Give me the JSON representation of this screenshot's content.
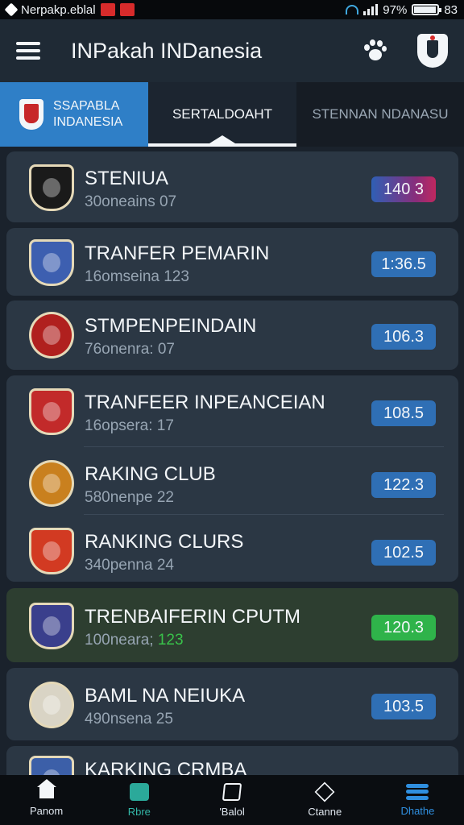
{
  "status_bar": {
    "carrier_text": "Nerpakp.eblal",
    "battery_text": "97%",
    "time": "83",
    "battery_level": 0.97
  },
  "app_bar": {
    "title": "INPakah INDanesia"
  },
  "tabs": [
    {
      "label": "SSAPABLA\nINDANESIA"
    },
    {
      "label": "SERTALDOAHT"
    },
    {
      "label": "STENNAN NDANASU"
    }
  ],
  "rows": [
    {
      "title": "STENIUA",
      "subtitle": "30oneains 07",
      "badge": "140 3",
      "logo_color": "#1a1a1a",
      "logo_shape": "shield"
    },
    {
      "title": "TRANFER PEMARIN",
      "subtitle": "16omseina 123",
      "badge": "1:36.5",
      "logo_color": "#3d5fb0",
      "logo_shape": "shield"
    },
    {
      "title": "STMPENPEINDAIN",
      "subtitle": "76onenra: 07",
      "badge": "106.3",
      "logo_color": "#b0201e",
      "logo_shape": "round"
    },
    {
      "title": "TRANFEER INPEANCEIAN",
      "subtitle": "16opsera: 17",
      "badge": "108.5",
      "logo_color": "#c22a2a",
      "logo_shape": "shield"
    },
    {
      "title": "RAKING CLUB",
      "subtitle": "580nenpe 22",
      "badge": "122.3",
      "logo_color": "#c9801e",
      "logo_shape": "round"
    },
    {
      "title": "RANKING CLURS",
      "subtitle": "340penna 24",
      "badge": "102.5",
      "logo_color": "#d23a22",
      "logo_shape": "shield"
    },
    {
      "title": "TRENBAIFERIN CPUTM",
      "subtitle_prefix": "100neara;",
      "subtitle_highlight": "123",
      "badge": "120.3",
      "logo_color": "#3a3f8c",
      "logo_shape": "shield"
    },
    {
      "title": "BAML NA NEIUKA",
      "subtitle": "490nsena 25",
      "badge": "103.5",
      "logo_color": "#d9d4c5",
      "logo_shape": "round"
    },
    {
      "title": "KARKING CRMBA",
      "subtitle": "",
      "badge": "",
      "logo_color": "#3c5fa8",
      "logo_shape": "shield"
    }
  ],
  "bottom_nav": [
    {
      "label": "Panom",
      "icon": "home-icon"
    },
    {
      "label": "Rbre",
      "icon": "square-icon"
    },
    {
      "label": "'Balol",
      "icon": "frame-icon"
    },
    {
      "label": "Ctanne",
      "icon": "cube-icon"
    },
    {
      "label": "Dhathe",
      "icon": "stack-icon"
    }
  ],
  "colors": {
    "accent_blue": "#2f7fc7",
    "badge_blue": "#2f6fb5",
    "badge_green": "#2fb34a",
    "highlight_card": "#2d3e30"
  }
}
